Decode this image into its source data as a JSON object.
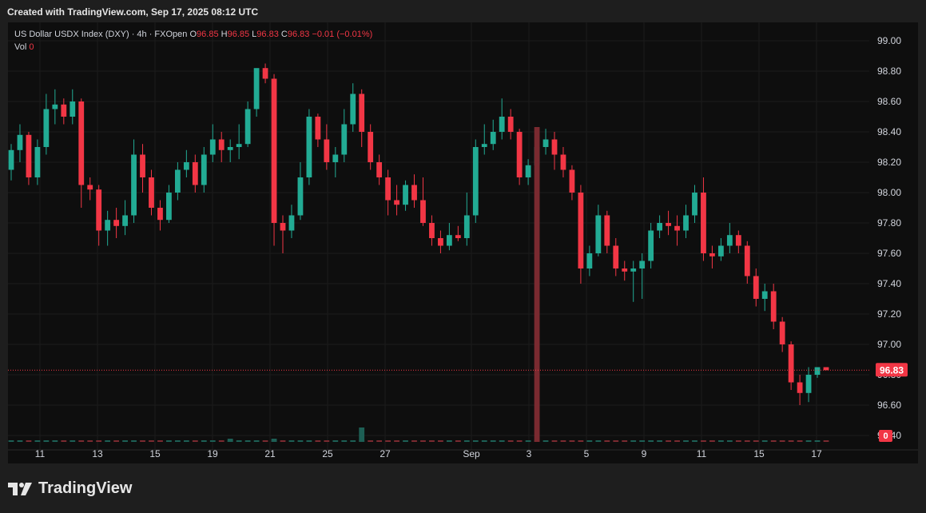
{
  "header": {
    "created_text": "Created with TradingView.com, Sep 17, 2025 08:12 UTC"
  },
  "legend": {
    "symbol": "US Dollar USDX Index (DXY) · 4h · FXOpen",
    "o_label": "O",
    "o_value": "96.85",
    "h_label": "H",
    "h_value": "96.85",
    "l_label": "L",
    "l_value": "96.83",
    "c_label": "C",
    "c_value": "96.83",
    "change": "−0.01 (−0.01%)",
    "vol_label": "Vol",
    "vol_value": "0"
  },
  "price_badge": "96.83",
  "vol_badge": "0",
  "footer": {
    "brand": "TradingView"
  },
  "colors": {
    "up": "#22ab94",
    "down": "#f23645",
    "background": "#0e0e0e",
    "grid": "#1c1c1c",
    "text": "#d1d4dc"
  },
  "chart_data": {
    "type": "candlestick",
    "title": "US Dollar USDX Index (DXY) · 4h · FXOpen",
    "ylim": [
      96.4,
      99.1
    ],
    "yticks": [
      "99.00",
      "98.80",
      "98.60",
      "98.40",
      "98.20",
      "98.00",
      "97.80",
      "97.60",
      "97.40",
      "97.20",
      "97.00",
      "96.80",
      "96.60",
      "96.40"
    ],
    "xticks": [
      "11",
      "13",
      "15",
      "19",
      "21",
      "25",
      "27",
      "Sep",
      "3",
      "5",
      "9",
      "11",
      "15",
      "17"
    ],
    "last_price": 96.83,
    "grid": true,
    "candles": [
      [
        98.15,
        98.32,
        98.08,
        98.28
      ],
      [
        98.28,
        98.45,
        98.2,
        98.38
      ],
      [
        98.38,
        98.4,
        98.05,
        98.1
      ],
      [
        98.1,
        98.35,
        98.05,
        98.3
      ],
      [
        98.3,
        98.65,
        98.25,
        98.55
      ],
      [
        98.55,
        98.68,
        98.45,
        98.58
      ],
      [
        98.58,
        98.62,
        98.45,
        98.5
      ],
      [
        98.5,
        98.68,
        98.45,
        98.6
      ],
      [
        98.6,
        98.62,
        97.9,
        98.05
      ],
      [
        98.05,
        98.1,
        97.95,
        98.02
      ],
      [
        98.02,
        98.05,
        97.65,
        97.75
      ],
      [
        97.75,
        97.88,
        97.65,
        97.82
      ],
      [
        97.82,
        97.9,
        97.7,
        97.78
      ],
      [
        97.78,
        97.95,
        97.72,
        97.85
      ],
      [
        97.85,
        98.35,
        97.8,
        98.25
      ],
      [
        98.25,
        98.32,
        98.0,
        98.1
      ],
      [
        98.1,
        98.15,
        97.85,
        97.9
      ],
      [
        97.9,
        97.95,
        97.75,
        97.82
      ],
      [
        97.82,
        98.05,
        97.8,
        98.0
      ],
      [
        98.0,
        98.2,
        97.95,
        98.15
      ],
      [
        98.15,
        98.28,
        98.1,
        98.2
      ],
      [
        98.2,
        98.25,
        98.0,
        98.05
      ],
      [
        98.05,
        98.3,
        98.0,
        98.25
      ],
      [
        98.25,
        98.45,
        98.2,
        98.35
      ],
      [
        98.35,
        98.4,
        98.2,
        98.28
      ],
      [
        98.28,
        98.35,
        98.2,
        98.3
      ],
      [
        98.3,
        98.45,
        98.22,
        98.32
      ],
      [
        98.32,
        98.6,
        98.3,
        98.55
      ],
      [
        98.55,
        98.8,
        98.5,
        98.82
      ],
      [
        98.82,
        98.85,
        98.72,
        98.75
      ],
      [
        98.75,
        98.78,
        97.65,
        97.8
      ],
      [
        97.8,
        97.85,
        97.6,
        97.75
      ],
      [
        97.75,
        97.92,
        97.7,
        97.85
      ],
      [
        97.85,
        98.2,
        97.82,
        98.1
      ],
      [
        98.1,
        98.55,
        98.05,
        98.5
      ],
      [
        98.5,
        98.52,
        98.3,
        98.35
      ],
      [
        98.35,
        98.45,
        98.15,
        98.2
      ],
      [
        98.2,
        98.3,
        98.1,
        98.25
      ],
      [
        98.25,
        98.55,
        98.2,
        98.45
      ],
      [
        98.45,
        98.72,
        98.4,
        98.65
      ],
      [
        98.65,
        98.68,
        98.3,
        98.4
      ],
      [
        98.4,
        98.45,
        98.15,
        98.2
      ],
      [
        98.2,
        98.25,
        98.05,
        98.1
      ],
      [
        98.1,
        98.15,
        97.85,
        97.95
      ],
      [
        97.95,
        98.05,
        97.85,
        97.92
      ],
      [
        97.92,
        98.08,
        97.88,
        98.05
      ],
      [
        98.05,
        98.12,
        97.9,
        97.95
      ],
      [
        97.95,
        98.1,
        97.78,
        97.8
      ],
      [
        97.8,
        97.85,
        97.65,
        97.7
      ],
      [
        97.7,
        97.75,
        97.6,
        97.65
      ],
      [
        97.65,
        97.8,
        97.62,
        97.72
      ],
      [
        97.72,
        97.78,
        97.68,
        97.7
      ],
      [
        97.7,
        98.0,
        97.65,
        97.85
      ],
      [
        97.85,
        98.35,
        97.8,
        98.3
      ],
      [
        98.3,
        98.45,
        98.25,
        98.32
      ],
      [
        98.32,
        98.48,
        98.28,
        98.4
      ],
      [
        98.4,
        98.62,
        98.35,
        98.5
      ],
      [
        98.5,
        98.55,
        98.35,
        98.4
      ],
      [
        98.4,
        98.42,
        98.05,
        98.1
      ],
      [
        98.1,
        98.22,
        98.05,
        98.18
      ],
      [
        98.18,
        98.35,
        98.15,
        98.3
      ],
      [
        98.3,
        98.42,
        98.25,
        98.35
      ],
      [
        98.35,
        98.4,
        98.15,
        98.25
      ],
      [
        98.25,
        98.3,
        98.1,
        98.15
      ],
      [
        98.15,
        98.18,
        97.95,
        98.0
      ],
      [
        98.0,
        98.05,
        97.4,
        97.5
      ],
      [
        97.5,
        97.65,
        97.45,
        97.6
      ],
      [
        97.6,
        97.92,
        97.58,
        97.85
      ],
      [
        97.85,
        97.88,
        97.6,
        97.65
      ],
      [
        97.65,
        97.7,
        97.45,
        97.5
      ],
      [
        97.5,
        97.55,
        97.42,
        97.48
      ],
      [
        97.48,
        97.55,
        97.28,
        97.5
      ],
      [
        97.5,
        97.6,
        97.3,
        97.55
      ],
      [
        97.55,
        97.8,
        97.5,
        97.75
      ],
      [
        97.75,
        97.85,
        97.7,
        97.8
      ],
      [
        97.8,
        97.88,
        97.72,
        97.78
      ],
      [
        97.78,
        97.85,
        97.65,
        97.75
      ],
      [
        97.75,
        97.92,
        97.7,
        97.85
      ],
      [
        97.85,
        98.05,
        97.8,
        98.0
      ],
      [
        98.0,
        98.1,
        97.55,
        97.6
      ],
      [
        97.6,
        97.65,
        97.5,
        97.58
      ],
      [
        97.58,
        97.7,
        97.55,
        97.65
      ],
      [
        97.65,
        97.8,
        97.6,
        97.72
      ],
      [
        97.72,
        97.75,
        97.6,
        97.65
      ],
      [
        97.65,
        97.68,
        97.4,
        97.45
      ],
      [
        97.45,
        97.5,
        97.25,
        97.3
      ],
      [
        97.3,
        97.4,
        97.22,
        97.35
      ],
      [
        97.35,
        97.4,
        97.1,
        97.15
      ],
      [
        97.15,
        97.18,
        96.95,
        97.0
      ],
      [
        97.0,
        97.02,
        96.7,
        96.75
      ],
      [
        96.75,
        96.8,
        96.6,
        96.68
      ],
      [
        96.68,
        96.85,
        96.62,
        96.8
      ],
      [
        96.8,
        96.85,
        96.78,
        96.85
      ],
      [
        96.85,
        96.85,
        96.83,
        96.83
      ]
    ],
    "volumes": [
      0,
      0,
      0,
      0,
      0,
      0,
      0,
      0,
      0,
      0,
      0,
      0,
      0,
      0,
      0,
      0,
      0,
      0,
      0,
      0,
      0,
      0,
      0,
      0,
      0,
      0,
      0,
      0,
      0,
      0,
      0,
      0,
      0,
      0,
      0,
      0,
      0,
      0,
      0,
      0,
      0,
      0,
      0,
      0,
      0,
      0,
      0,
      0,
      0,
      0,
      0,
      0,
      0,
      0,
      0,
      0,
      0,
      0,
      0,
      0,
      0,
      0,
      0,
      0,
      0,
      0,
      0,
      0,
      0,
      0,
      0,
      0,
      0,
      0,
      0,
      0,
      0,
      0,
      0,
      0,
      0,
      0,
      0,
      0,
      0,
      0,
      0,
      0,
      0,
      0,
      0,
      0,
      0,
      0
    ]
  }
}
